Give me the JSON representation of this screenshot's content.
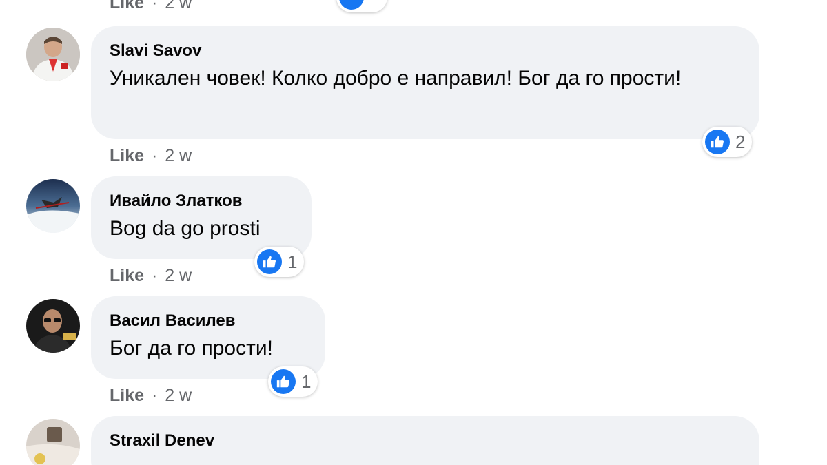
{
  "top_meta": {
    "like_label": "Like",
    "separator": "·",
    "time": "2 w"
  },
  "comments": [
    {
      "author": "Slavi Savov",
      "text": "Уникален човек! Колко добро е направил! Бог да го прости!",
      "reactions_count": "2",
      "like_label": "Like",
      "separator": "·",
      "time": "2 w"
    },
    {
      "author": "Ивайло Златков",
      "text": "Bog da go prosti",
      "reactions_count": "1",
      "like_label": "Like",
      "separator": "·",
      "time": "2 w"
    },
    {
      "author": "Васил Василев",
      "text": "Бог да го прости!",
      "reactions_count": "1",
      "like_label": "Like",
      "separator": "·",
      "time": "2 w"
    },
    {
      "author": "Straxil Denev",
      "text": "",
      "reactions_count": "",
      "like_label": "",
      "separator": "",
      "time": ""
    }
  ],
  "colors": {
    "bubble": "#f0f2f5",
    "like_blue": "#1877f2",
    "meta_gray": "#65676b",
    "text": "#050505"
  },
  "icons": {
    "reaction": "like-thumb-icon",
    "avatar": "avatar"
  }
}
